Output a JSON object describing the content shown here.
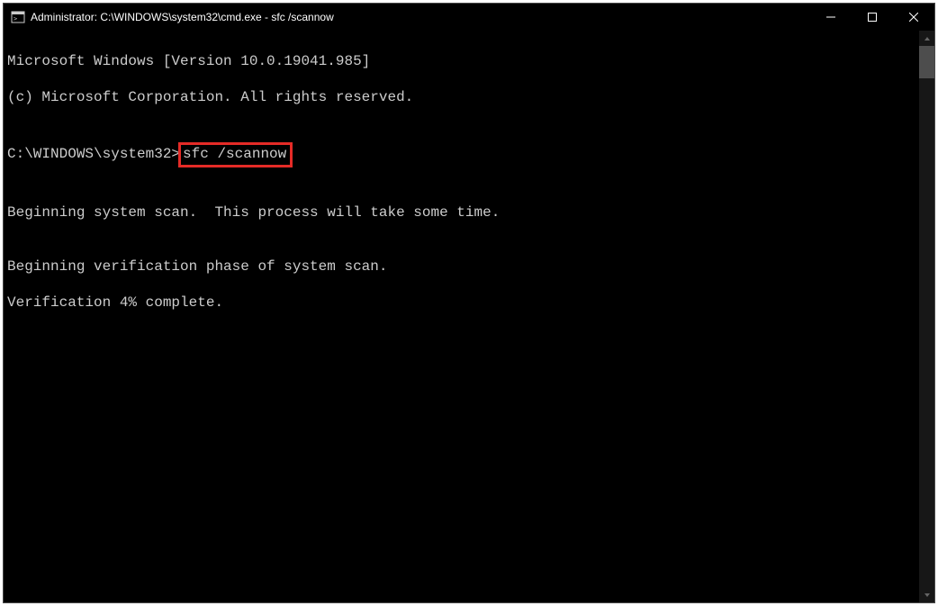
{
  "window": {
    "title": "Administrator: C:\\WINDOWS\\system32\\cmd.exe - sfc  /scannow"
  },
  "terminal": {
    "line1": "Microsoft Windows [Version 10.0.19041.985]",
    "line2": "(c) Microsoft Corporation. All rights reserved.",
    "blank1": "",
    "prompt_path": "C:\\WINDOWS\\system32>",
    "prompt_cmd": "sfc /scannow",
    "blank2": "",
    "line3": "Beginning system scan.  This process will take some time.",
    "blank3": "",
    "line4": "Beginning verification phase of system scan.",
    "line5": "Verification 4% complete."
  }
}
